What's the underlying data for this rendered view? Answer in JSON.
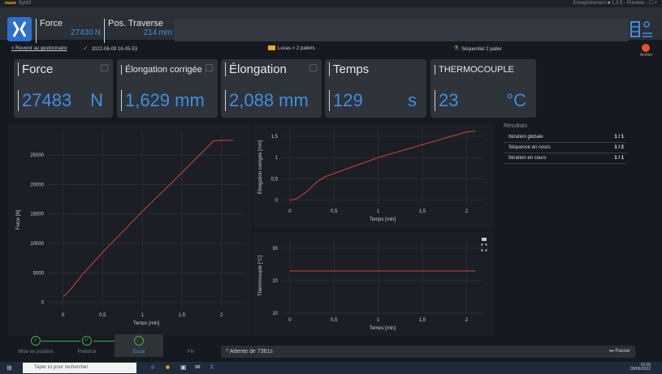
{
  "window": {
    "app_name": "Synt3",
    "right_status": "Enregistrement ■  1.3.5 - Preview  -  ☐  ×"
  },
  "topbar": {
    "channels": [
      {
        "label": "Force",
        "value": "27430",
        "unit": "N"
      },
      {
        "label": "Pos. Traverse",
        "value": "214",
        "unit": "mm"
      }
    ]
  },
  "subbar": {
    "back_link": "< Revenir au gestionnaire",
    "datetime": "2022-06-09 16-05-53",
    "folder": "Lucas > 2 paliers",
    "sequence": "Séquentiel 2 palier",
    "stop_label": "Arrêter"
  },
  "cards": [
    {
      "title": "Force",
      "value": "27483",
      "unit": "N"
    },
    {
      "title": "Élongation corrigée",
      "value": "1,629 mm",
      "unit": ""
    },
    {
      "title": "Élongation",
      "value": "2,088 mm",
      "unit": ""
    },
    {
      "title": "Temps",
      "value": "129",
      "unit": "s"
    },
    {
      "title": "THERMOCOUPLE",
      "value": "23",
      "unit": "°C"
    }
  ],
  "results": {
    "title": "Résultats",
    "rows": [
      {
        "label": "Itération globale",
        "value": "1 / 1"
      },
      {
        "label": "Séquence en cours",
        "value": "1 / 2"
      },
      {
        "label": "Itération en cours",
        "value": "1 / 1"
      }
    ]
  },
  "steps": [
    {
      "label": "Mise en position",
      "state": "done"
    },
    {
      "label": "Preforce",
      "state": "done"
    },
    {
      "label": "Essai",
      "state": "active"
    },
    {
      "label": "Fin",
      "state": "pending"
    }
  ],
  "waitbar": {
    "text": "^ Attente de 7361s",
    "skip_label": "Passer"
  },
  "taskbar": {
    "search_placeholder": "Taper ici pour rechercher",
    "time": "16:06",
    "date": "09/06/2022"
  },
  "colors": {
    "accent": "#3f8fe0",
    "curve": "#d2463c",
    "ok": "#3fb24a"
  },
  "chart_data": [
    {
      "type": "line",
      "xlabel": "Temps [min]",
      "ylabel": "Force [N]",
      "xlim": [
        -0.2,
        2.3
      ],
      "ylim": [
        -1000,
        29000
      ],
      "xticks": [
        0,
        0.5,
        1,
        1.5,
        2
      ],
      "xticklabels": [
        "0",
        "0,5",
        "1",
        "1,5",
        "2"
      ],
      "yticks": [
        0,
        5000,
        10000,
        15000,
        20000,
        25000
      ],
      "yticklabels": [
        "0",
        "5000",
        "10000",
        "15000",
        "20000",
        "25000"
      ],
      "series": [
        {
          "x": [
            0,
            0.05,
            0.1,
            0.25,
            0.5,
            1,
            1.5,
            1.9,
            2.0,
            2.15
          ],
          "y": [
            1000,
            1500,
            2300,
            4800,
            8500,
            15400,
            22000,
            27400,
            27483,
            27483
          ]
        }
      ]
    },
    {
      "type": "line",
      "xlabel": "Temps [min]",
      "ylabel": "Élongation corrigée [mm]",
      "xlim": [
        -0.1,
        2.2
      ],
      "ylim": [
        -0.1,
        1.65
      ],
      "xticks": [
        0,
        0.5,
        1,
        1.5,
        2
      ],
      "xticklabels": [
        "0",
        "0,5",
        "1",
        "1,5",
        "2"
      ],
      "yticks": [
        0,
        0.5,
        1,
        1.5
      ],
      "yticklabels": [
        "0",
        "0,5",
        "1",
        "1,5"
      ],
      "series": [
        {
          "x": [
            0,
            0.05,
            0.1,
            0.2,
            0.3,
            0.4,
            0.6,
            0.8,
            1.0,
            1.2,
            1.5,
            1.8,
            2.0,
            2.1
          ],
          "y": [
            0,
            0.02,
            0.06,
            0.22,
            0.42,
            0.55,
            0.7,
            0.85,
            1.0,
            1.12,
            1.3,
            1.48,
            1.6,
            1.62
          ]
        }
      ]
    },
    {
      "type": "line",
      "xlabel": "Temps [min]",
      "ylabel": "Thermocouple [°C]",
      "xlim": [
        -0.1,
        2.2
      ],
      "ylim": [
        10,
        33
      ],
      "xticks": [
        0,
        0.5,
        1,
        1.5,
        2
      ],
      "xticklabels": [
        "0",
        "0,5",
        "1",
        "1,5",
        "2"
      ],
      "yticks": [
        10,
        20,
        30
      ],
      "yticklabels": [
        "10",
        "20",
        "30"
      ],
      "series": [
        {
          "x": [
            0,
            2.1
          ],
          "y": [
            23,
            23
          ]
        }
      ]
    }
  ]
}
